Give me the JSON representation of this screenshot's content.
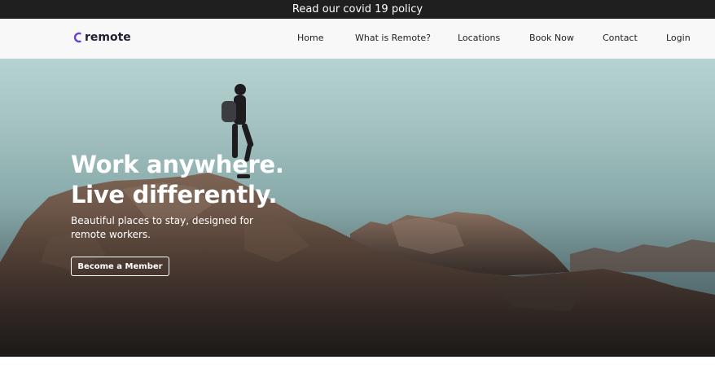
{
  "announcement": {
    "text": "Read our covid 19 policy"
  },
  "brand": {
    "name": "remote",
    "accent": "#6a3fd6"
  },
  "nav": {
    "items": [
      {
        "label": "Home"
      },
      {
        "label": "What is Remote?"
      },
      {
        "label": "Locations"
      },
      {
        "label": "Book Now"
      },
      {
        "label": "Contact"
      },
      {
        "label": "Login"
      }
    ]
  },
  "hero": {
    "headline_line1": "Work anywhere.",
    "headline_line2": "Live differently.",
    "subtext": "Beautiful places to stay, designed for remote workers.",
    "cta_label": "Become a Member"
  }
}
